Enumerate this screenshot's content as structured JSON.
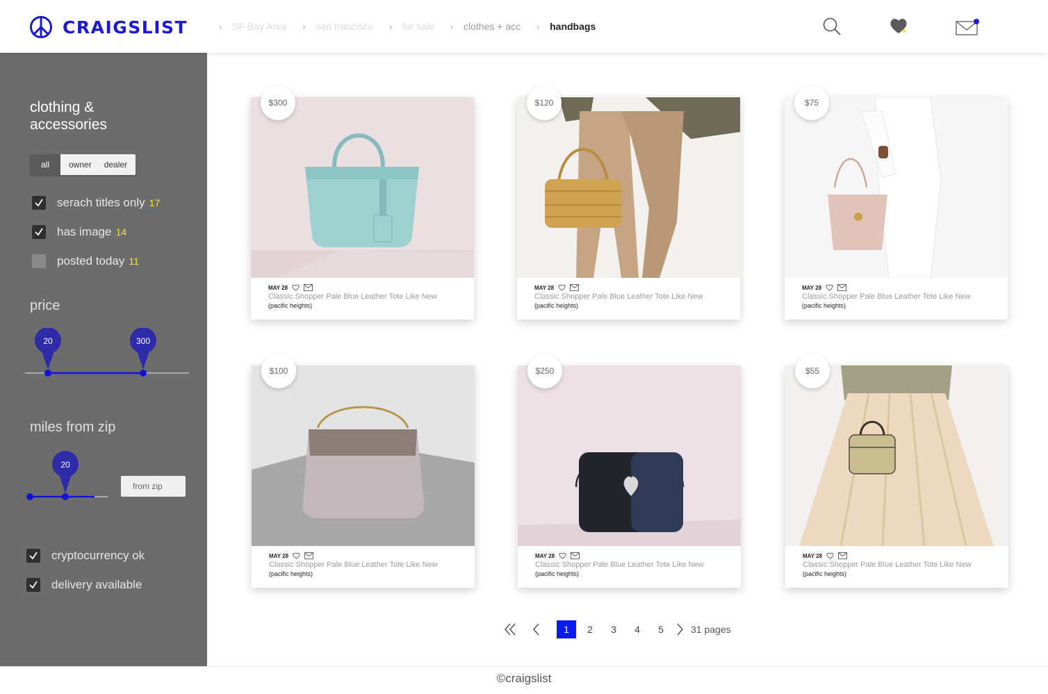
{
  "header": {
    "logo_text": "CRAIGSLIST",
    "breadcrumbs": [
      "SF Bay Area",
      "san francisco",
      "for sale",
      "clothes + acc",
      "handbags"
    ],
    "icons": [
      "search-icon",
      "favorites-heart-icon",
      "messages-envelope-icon"
    ]
  },
  "sidebar": {
    "title": "clothing & accessories",
    "seller_filter": [
      "all",
      "owner",
      "dealer"
    ],
    "selected_seller": "all",
    "checks": [
      {
        "label": "serach titles only",
        "count": "17",
        "checked": true
      },
      {
        "label": "has image",
        "count": "14",
        "checked": true
      },
      {
        "label": "posted today",
        "count": "11",
        "checked": false
      }
    ],
    "price_label": "price",
    "price_min": "20",
    "price_max": "300",
    "miles_label": "miles from zip",
    "miles_value": "20",
    "zip_placeholder": "from zip",
    "extra_checks": [
      {
        "label": "cryptocurrency ok",
        "checked": true
      },
      {
        "label": "delivery available",
        "checked": true
      }
    ]
  },
  "listings": [
    {
      "price": "$300",
      "date": "MAY 28",
      "title": "Classic Shopper Pale Blue Leather Tote Like New",
      "location": "(pacific heights)",
      "image": "pale-blue-leather-tote"
    },
    {
      "price": "$120",
      "date": "MAY 28",
      "title": "Classic Shopper Pale Blue Leather Tote Like New",
      "location": "(pacific heights)",
      "image": "woven-straw-bag"
    },
    {
      "price": "$75",
      "date": "MAY 28",
      "title": "Classic Shopper Pale Blue Leather Tote Like New",
      "location": "(pacific heights)",
      "image": "blush-leather-tote"
    },
    {
      "price": "$100",
      "date": "MAY 28",
      "title": "Classic Shopper Pale Blue Leather Tote Like New",
      "location": "(pacific heights)",
      "image": "taupe-chain-bag"
    },
    {
      "price": "$250",
      "date": "MAY 28",
      "title": "Classic Shopper Pale Blue Leather Tote Like New",
      "location": "(pacific heights)",
      "image": "navy-spade-crossbody"
    },
    {
      "price": "$55",
      "date": "MAY 28",
      "title": "Classic Shopper Pale Blue Leather Tote Like New",
      "location": "(pacific heights)",
      "image": "snakeskin-mini-bag"
    }
  ],
  "pagination": {
    "pages": [
      "1",
      "2",
      "3",
      "4",
      "5"
    ],
    "current": "1",
    "total_label": "31 pages"
  },
  "footer": {
    "text": "©craigslist"
  },
  "colors": {
    "brand_blue": "#1a1ad6",
    "active_page": "#0b1bef",
    "sidebar_bg": "#6d6c6d",
    "count_yellow": "#f3e43a",
    "slider_pin": "#2d2ba8"
  }
}
